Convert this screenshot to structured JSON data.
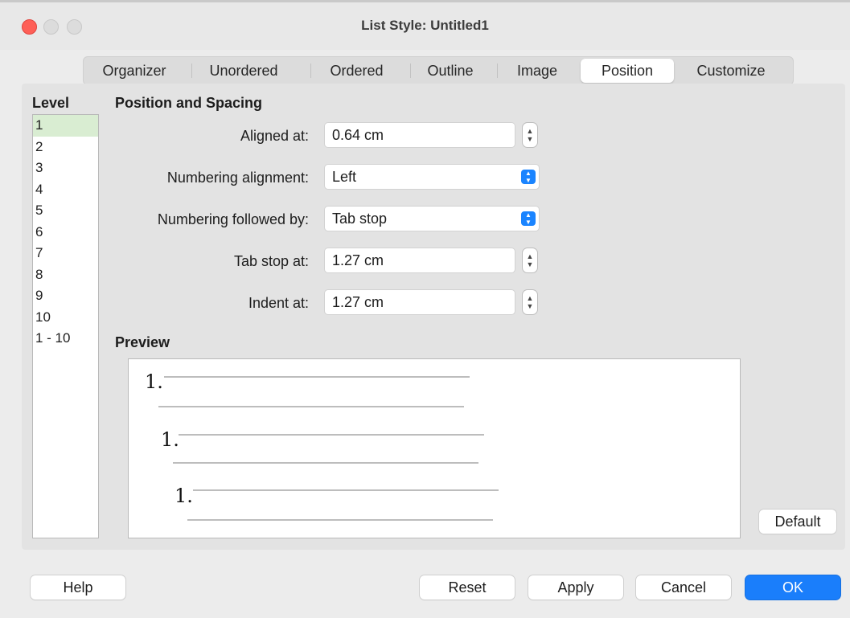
{
  "window": {
    "title": "List Style: Untitled1"
  },
  "tabs": [
    {
      "label": "Organizer"
    },
    {
      "label": "Unordered"
    },
    {
      "label": "Ordered"
    },
    {
      "label": "Outline"
    },
    {
      "label": "Image"
    },
    {
      "label": "Position"
    },
    {
      "label": "Customize"
    }
  ],
  "active_tab": "Position",
  "level": {
    "label": "Level",
    "items": [
      "1",
      "2",
      "3",
      "4",
      "5",
      "6",
      "7",
      "8",
      "9",
      "10",
      "1 - 10"
    ],
    "selected": "1"
  },
  "position": {
    "section_label": "Position and Spacing",
    "aligned_at": {
      "label": "Aligned at:",
      "value": "0.64 cm"
    },
    "numbering_alignment": {
      "label": "Numbering alignment:",
      "value": "Left"
    },
    "numbering_followed_by": {
      "label": "Numbering followed by:",
      "value": "Tab stop"
    },
    "tab_stop_at": {
      "label": "Tab stop at:",
      "value": "1.27 cm"
    },
    "indent_at": {
      "label": "Indent at:",
      "value": "1.27 cm"
    }
  },
  "preview": {
    "label": "Preview",
    "numbers": [
      "1.",
      "1.",
      "1."
    ]
  },
  "buttons": {
    "default": "Default",
    "help": "Help",
    "reset": "Reset",
    "apply": "Apply",
    "cancel": "Cancel",
    "ok": "OK"
  },
  "colors": {
    "accent": "#1a7efb",
    "selected_level": "#d9edd2",
    "close": "#fe5f57"
  }
}
